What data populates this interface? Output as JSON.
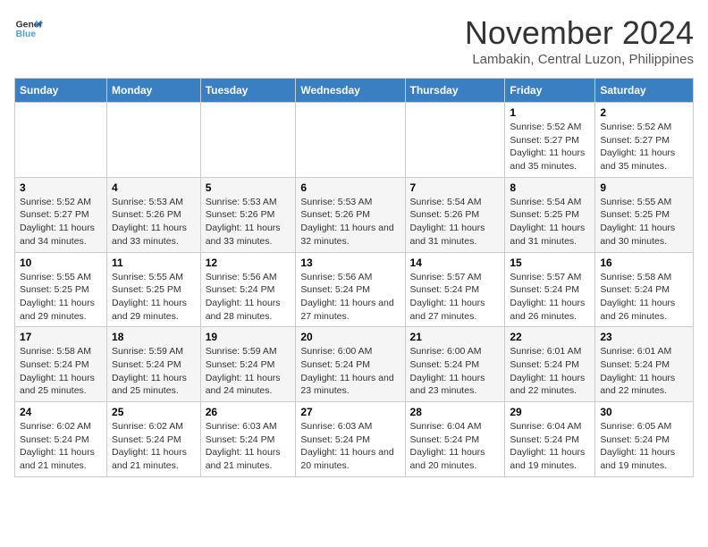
{
  "logo": {
    "line1": "General",
    "line2": "Blue"
  },
  "title": "November 2024",
  "subtitle": "Lambakin, Central Luzon, Philippines",
  "weekdays": [
    "Sunday",
    "Monday",
    "Tuesday",
    "Wednesday",
    "Thursday",
    "Friday",
    "Saturday"
  ],
  "weeks": [
    [
      {
        "day": "",
        "info": ""
      },
      {
        "day": "",
        "info": ""
      },
      {
        "day": "",
        "info": ""
      },
      {
        "day": "",
        "info": ""
      },
      {
        "day": "",
        "info": ""
      },
      {
        "day": "1",
        "info": "Sunrise: 5:52 AM\nSunset: 5:27 PM\nDaylight: 11 hours\nand 35 minutes."
      },
      {
        "day": "2",
        "info": "Sunrise: 5:52 AM\nSunset: 5:27 PM\nDaylight: 11 hours\nand 35 minutes."
      }
    ],
    [
      {
        "day": "3",
        "info": "Sunrise: 5:52 AM\nSunset: 5:27 PM\nDaylight: 11 hours\nand 34 minutes."
      },
      {
        "day": "4",
        "info": "Sunrise: 5:53 AM\nSunset: 5:26 PM\nDaylight: 11 hours\nand 33 minutes."
      },
      {
        "day": "5",
        "info": "Sunrise: 5:53 AM\nSunset: 5:26 PM\nDaylight: 11 hours\nand 33 minutes."
      },
      {
        "day": "6",
        "info": "Sunrise: 5:53 AM\nSunset: 5:26 PM\nDaylight: 11 hours\nand 32 minutes."
      },
      {
        "day": "7",
        "info": "Sunrise: 5:54 AM\nSunset: 5:26 PM\nDaylight: 11 hours\nand 31 minutes."
      },
      {
        "day": "8",
        "info": "Sunrise: 5:54 AM\nSunset: 5:25 PM\nDaylight: 11 hours\nand 31 minutes."
      },
      {
        "day": "9",
        "info": "Sunrise: 5:55 AM\nSunset: 5:25 PM\nDaylight: 11 hours\nand 30 minutes."
      }
    ],
    [
      {
        "day": "10",
        "info": "Sunrise: 5:55 AM\nSunset: 5:25 PM\nDaylight: 11 hours\nand 29 minutes."
      },
      {
        "day": "11",
        "info": "Sunrise: 5:55 AM\nSunset: 5:25 PM\nDaylight: 11 hours\nand 29 minutes."
      },
      {
        "day": "12",
        "info": "Sunrise: 5:56 AM\nSunset: 5:24 PM\nDaylight: 11 hours\nand 28 minutes."
      },
      {
        "day": "13",
        "info": "Sunrise: 5:56 AM\nSunset: 5:24 PM\nDaylight: 11 hours\nand 27 minutes."
      },
      {
        "day": "14",
        "info": "Sunrise: 5:57 AM\nSunset: 5:24 PM\nDaylight: 11 hours\nand 27 minutes."
      },
      {
        "day": "15",
        "info": "Sunrise: 5:57 AM\nSunset: 5:24 PM\nDaylight: 11 hours\nand 26 minutes."
      },
      {
        "day": "16",
        "info": "Sunrise: 5:58 AM\nSunset: 5:24 PM\nDaylight: 11 hours\nand 26 minutes."
      }
    ],
    [
      {
        "day": "17",
        "info": "Sunrise: 5:58 AM\nSunset: 5:24 PM\nDaylight: 11 hours\nand 25 minutes."
      },
      {
        "day": "18",
        "info": "Sunrise: 5:59 AM\nSunset: 5:24 PM\nDaylight: 11 hours\nand 25 minutes."
      },
      {
        "day": "19",
        "info": "Sunrise: 5:59 AM\nSunset: 5:24 PM\nDaylight: 11 hours\nand 24 minutes."
      },
      {
        "day": "20",
        "info": "Sunrise: 6:00 AM\nSunset: 5:24 PM\nDaylight: 11 hours\nand 23 minutes."
      },
      {
        "day": "21",
        "info": "Sunrise: 6:00 AM\nSunset: 5:24 PM\nDaylight: 11 hours\nand 23 minutes."
      },
      {
        "day": "22",
        "info": "Sunrise: 6:01 AM\nSunset: 5:24 PM\nDaylight: 11 hours\nand 22 minutes."
      },
      {
        "day": "23",
        "info": "Sunrise: 6:01 AM\nSunset: 5:24 PM\nDaylight: 11 hours\nand 22 minutes."
      }
    ],
    [
      {
        "day": "24",
        "info": "Sunrise: 6:02 AM\nSunset: 5:24 PM\nDaylight: 11 hours\nand 21 minutes."
      },
      {
        "day": "25",
        "info": "Sunrise: 6:02 AM\nSunset: 5:24 PM\nDaylight: 11 hours\nand 21 minutes."
      },
      {
        "day": "26",
        "info": "Sunrise: 6:03 AM\nSunset: 5:24 PM\nDaylight: 11 hours\nand 21 minutes."
      },
      {
        "day": "27",
        "info": "Sunrise: 6:03 AM\nSunset: 5:24 PM\nDaylight: 11 hours\nand 20 minutes."
      },
      {
        "day": "28",
        "info": "Sunrise: 6:04 AM\nSunset: 5:24 PM\nDaylight: 11 hours\nand 20 minutes."
      },
      {
        "day": "29",
        "info": "Sunrise: 6:04 AM\nSunset: 5:24 PM\nDaylight: 11 hours\nand 19 minutes."
      },
      {
        "day": "30",
        "info": "Sunrise: 6:05 AM\nSunset: 5:24 PM\nDaylight: 11 hours\nand 19 minutes."
      }
    ]
  ]
}
